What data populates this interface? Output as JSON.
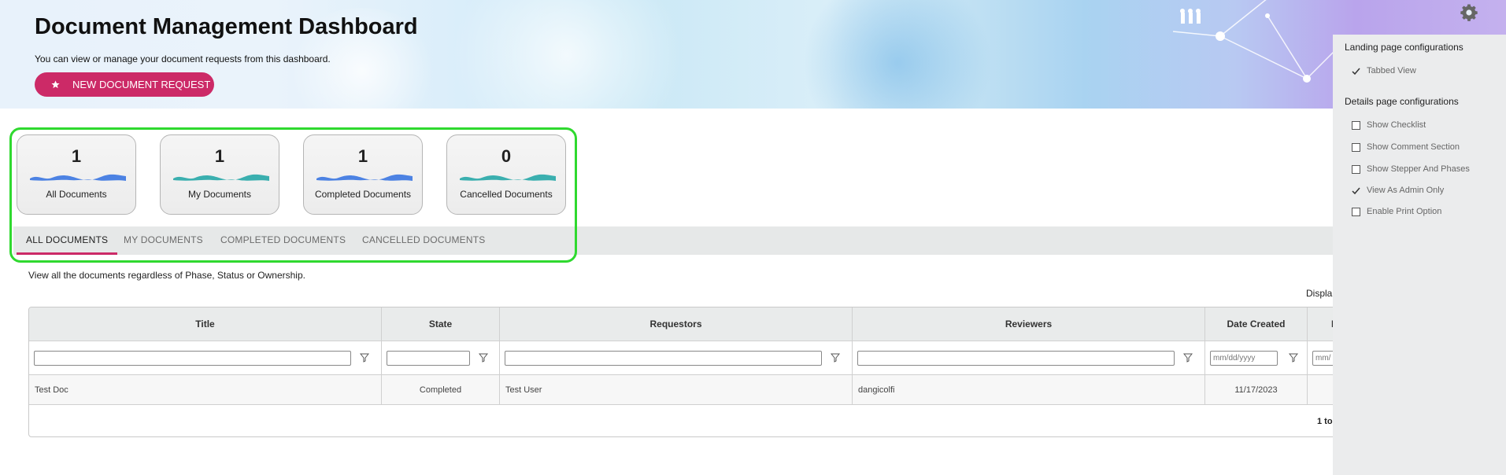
{
  "header": {
    "title": "Document Management Dashboard",
    "subtitle": "You can view or manage your document requests from this dashboard.",
    "new_request_label": "NEW DOCUMENT REQUEST"
  },
  "stats": [
    {
      "count": "1",
      "label": "All Documents",
      "wave_color": "#2f6fe0"
    },
    {
      "count": "1",
      "label": "My Documents",
      "wave_color": "#1aa3a3"
    },
    {
      "count": "1",
      "label": "Completed Documents",
      "wave_color": "#2f6fe0"
    },
    {
      "count": "0",
      "label": "Cancelled Documents",
      "wave_color": "#1aa3a3"
    }
  ],
  "tabs": [
    {
      "label": "ALL DOCUMENTS",
      "active": true
    },
    {
      "label": "MY DOCUMENTS",
      "active": false
    },
    {
      "label": "COMPLETED DOCUMENTS",
      "active": false
    },
    {
      "label": "CANCELLED DOCUMENTS",
      "active": false
    }
  ],
  "view_description": "View all the documents regardless of Phase, Status or Ownership.",
  "display_label": "Displa",
  "grid": {
    "columns": [
      "Title",
      "State",
      "Requestors",
      "Reviewers",
      "Date Created",
      "D"
    ],
    "filters": {
      "date_placeholder": "mm/dd/yyyy",
      "date_placeholder_partial": "mm/"
    },
    "rows": [
      {
        "title": "Test Doc",
        "state": "Completed",
        "requestors": "Test User",
        "reviewers": "dangicolfi",
        "date_created": "11/17/2023"
      }
    ],
    "pager_text": "1 to"
  },
  "config_panel": {
    "landing_heading": "Landing page configurations",
    "landing_options": [
      {
        "label": "Tabbed View",
        "checked": true
      }
    ],
    "details_heading": "Details page configurations",
    "details_options": [
      {
        "label": "Show Checklist",
        "checked": false
      },
      {
        "label": "Show Comment Section",
        "checked": false
      },
      {
        "label": "Show Stepper And Phases",
        "checked": false
      },
      {
        "label": "View As Admin Only",
        "checked": true
      },
      {
        "label": "Enable Print Option",
        "checked": false
      }
    ]
  },
  "colors": {
    "accent": "#cc2a67",
    "highlight": "#2fd92f",
    "tab_bar": "#e6e8e8",
    "panel": "#ebeced"
  }
}
